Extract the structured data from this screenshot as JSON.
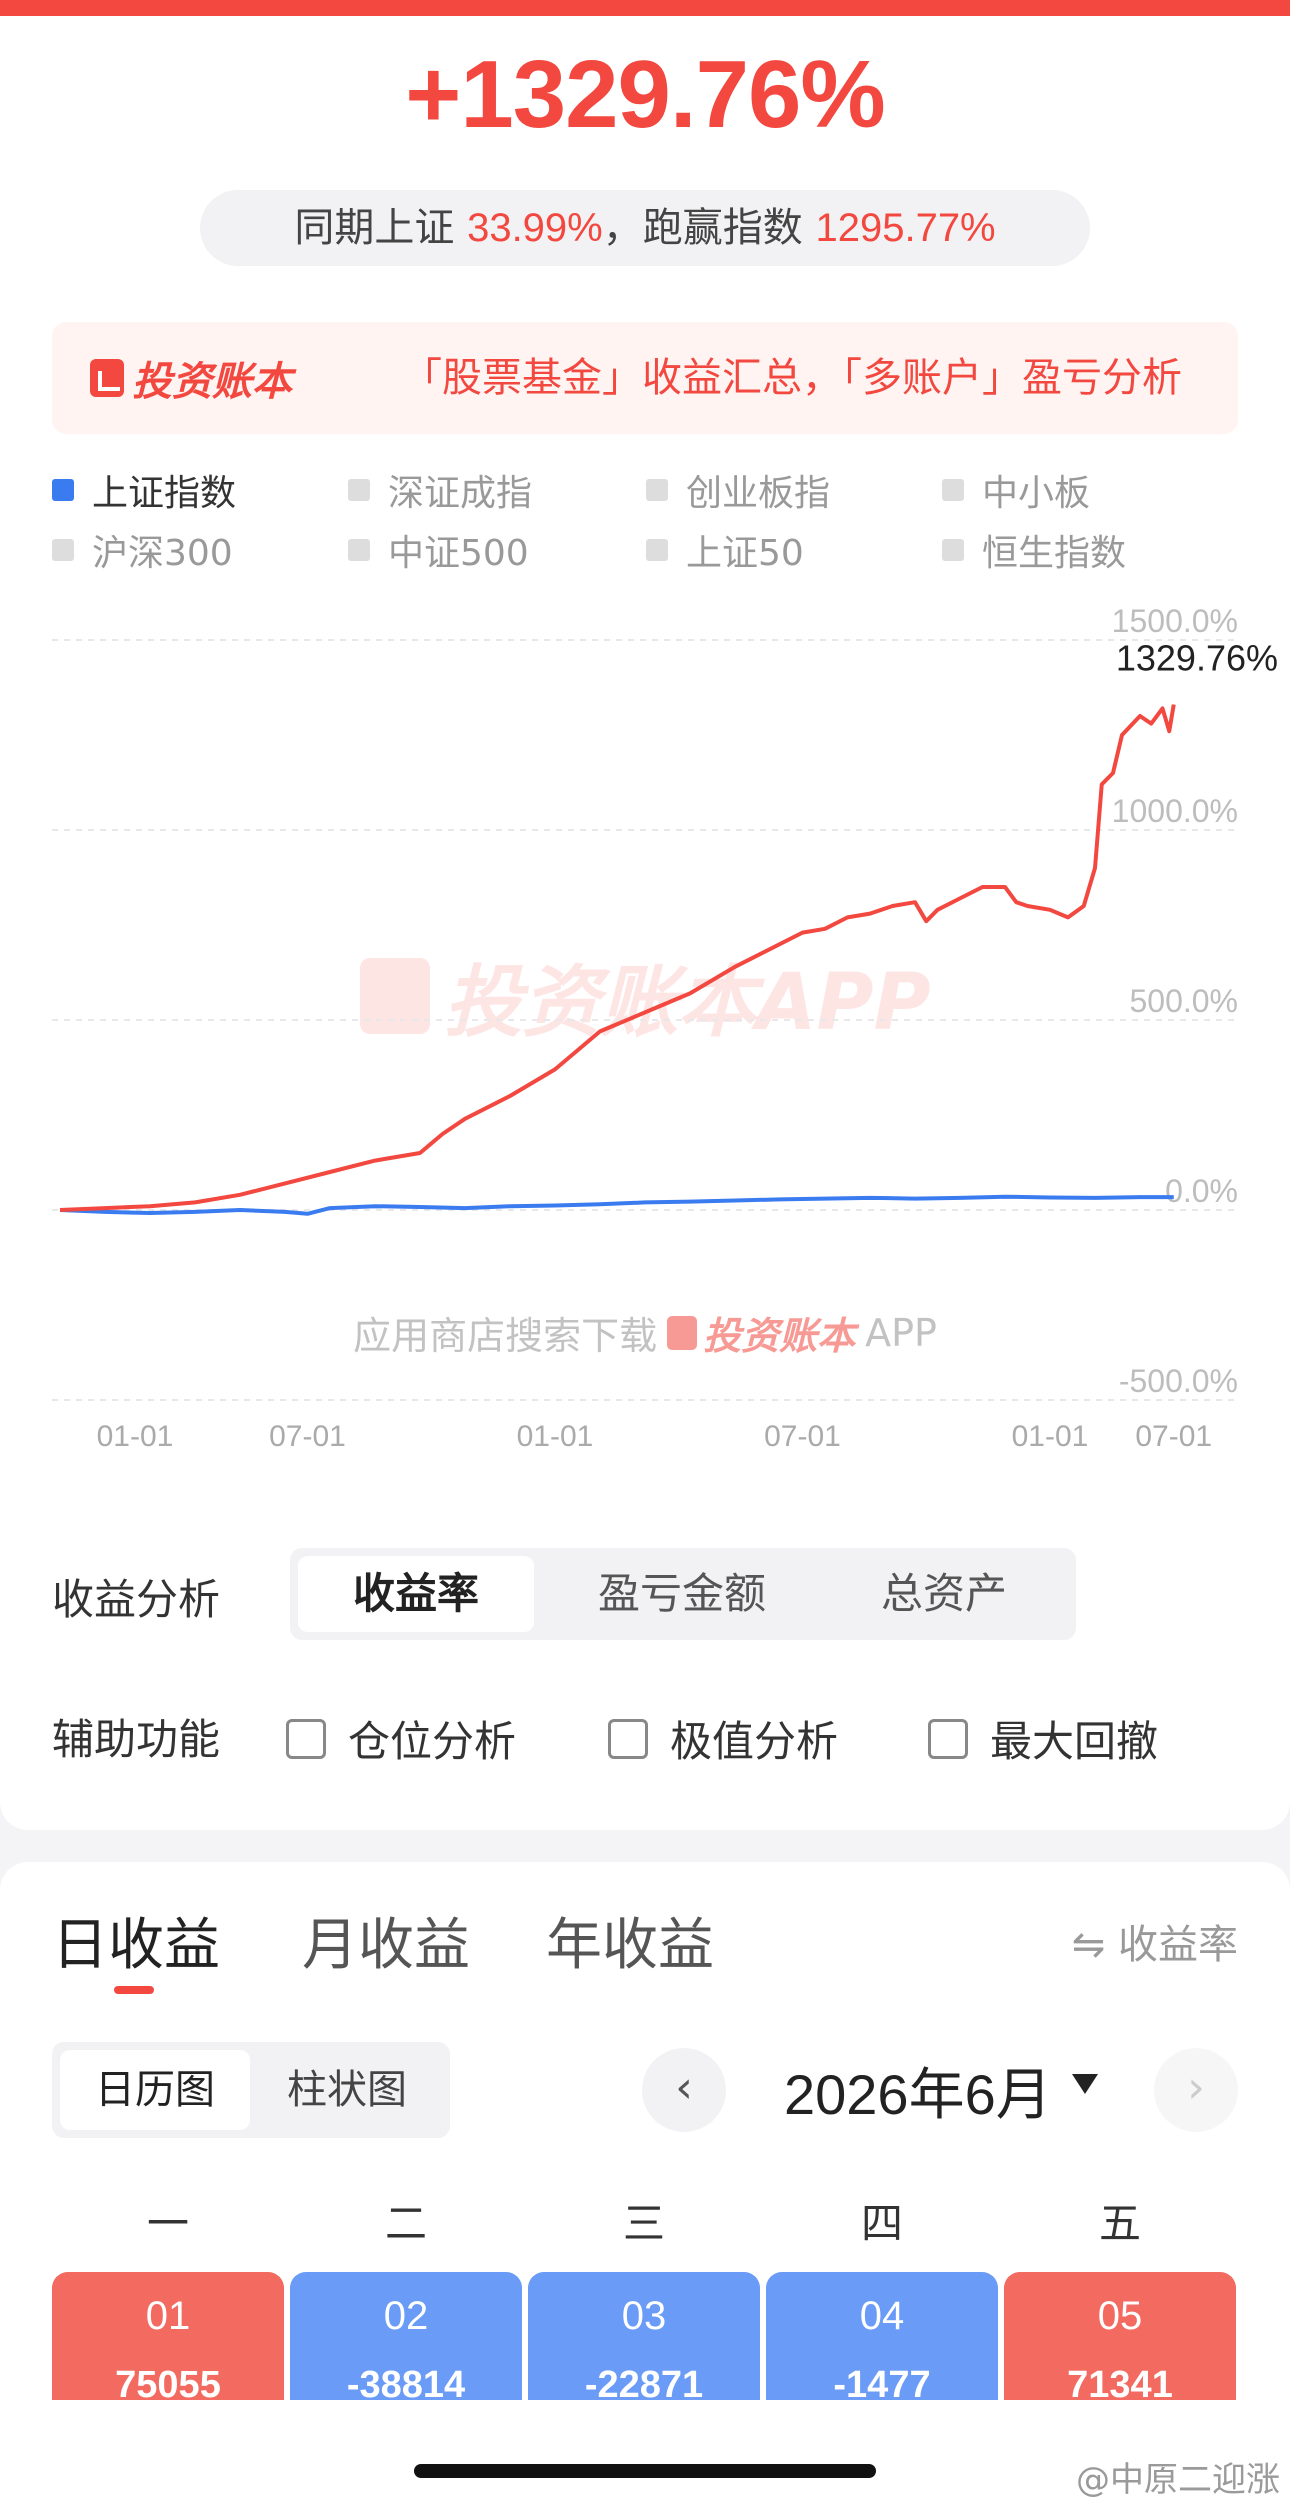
{
  "header": {
    "total_return": "+1329.76%",
    "compare_prefix": "同期上证 ",
    "compare_index_value": "33.99%",
    "compare_mid": "，跑赢指数 ",
    "compare_outperform_value": "1295.77%"
  },
  "promo": {
    "logo_text": "投资账本",
    "text": "「股票基金」收益汇总，「多账户」盈亏分析"
  },
  "legend": [
    {
      "label": "上证指数",
      "active": true
    },
    {
      "label": "深证成指",
      "active": false
    },
    {
      "label": "创业板指",
      "active": false
    },
    {
      "label": "中小板",
      "active": false
    },
    {
      "label": "沪深300",
      "active": false
    },
    {
      "label": "中证500",
      "active": false
    },
    {
      "label": "上证50",
      "active": false
    },
    {
      "label": "恒生指数",
      "active": false
    }
  ],
  "chart_data": {
    "type": "line",
    "y_ticks": [
      "1500.0%",
      "1000.0%",
      "500.0%",
      "0.0%",
      "-500.0%"
    ],
    "ylim": [
      -500,
      1500
    ],
    "x_ticks": [
      "01-01",
      "07-01",
      "01-01",
      "07-01",
      "01-01",
      "07-01"
    ],
    "end_label": "1329.76%",
    "series": [
      {
        "name": "",
        "color": "#f2483f",
        "points": [
          [
            0,
            0
          ],
          [
            2,
            5
          ],
          [
            4,
            10
          ],
          [
            6,
            20
          ],
          [
            8,
            40
          ],
          [
            10,
            70
          ],
          [
            12,
            100
          ],
          [
            14,
            130
          ],
          [
            16,
            150
          ],
          [
            17,
            200
          ],
          [
            18,
            240
          ],
          [
            20,
            300
          ],
          [
            22,
            370
          ],
          [
            23,
            420
          ],
          [
            24,
            470
          ],
          [
            26,
            520
          ],
          [
            28,
            570
          ],
          [
            30,
            640
          ],
          [
            32,
            700
          ],
          [
            33,
            730
          ],
          [
            34,
            740
          ],
          [
            35,
            770
          ],
          [
            36,
            780
          ],
          [
            37,
            800
          ],
          [
            38,
            810
          ],
          [
            38.5,
            760
          ],
          [
            39,
            790
          ],
          [
            40,
            820
          ],
          [
            41,
            850
          ],
          [
            42,
            850
          ],
          [
            42.5,
            810
          ],
          [
            43,
            800
          ],
          [
            44,
            790
          ],
          [
            44.8,
            770
          ],
          [
            45.5,
            800
          ],
          [
            46,
            900
          ],
          [
            46.3,
            1120
          ],
          [
            46.8,
            1150
          ],
          [
            47.2,
            1250
          ],
          [
            48,
            1300
          ],
          [
            48.5,
            1280
          ],
          [
            49,
            1320
          ],
          [
            49.3,
            1260
          ],
          [
            49.5,
            1330
          ]
        ]
      },
      {
        "name": "上证指数",
        "color": "#3b7bf0",
        "points": [
          [
            0,
            0
          ],
          [
            2,
            -5
          ],
          [
            4,
            -8
          ],
          [
            6,
            -5
          ],
          [
            8,
            0
          ],
          [
            10,
            -5
          ],
          [
            11,
            -10
          ],
          [
            12,
            5
          ],
          [
            14,
            10
          ],
          [
            16,
            8
          ],
          [
            18,
            5
          ],
          [
            20,
            10
          ],
          [
            22,
            12
          ],
          [
            24,
            15
          ],
          [
            26,
            20
          ],
          [
            28,
            22
          ],
          [
            30,
            25
          ],
          [
            32,
            28
          ],
          [
            34,
            30
          ],
          [
            36,
            32
          ],
          [
            38,
            30
          ],
          [
            40,
            32
          ],
          [
            42,
            35
          ],
          [
            44,
            33
          ],
          [
            46,
            32
          ],
          [
            48,
            34
          ],
          [
            49.5,
            34
          ]
        ]
      }
    ]
  },
  "watermark": {
    "text": "投资账本APP",
    "download_note": "应用商店搜索下载",
    "download_app": "投资账本",
    "download_suffix": "APP"
  },
  "analysis": {
    "label": "收益分析",
    "options": [
      "收益率",
      "盈亏金额",
      "总资产"
    ],
    "selected": "收益率"
  },
  "aux": {
    "label": "辅助功能",
    "options": [
      "仓位分析",
      "极值分析",
      "最大回撤"
    ]
  },
  "returns": {
    "tabs": [
      "日收益",
      "月收益",
      "年收益"
    ],
    "selected_tab": "日收益",
    "switch_label": "⇋ 收益率",
    "views": [
      "日历图",
      "柱状图"
    ],
    "selected_view": "日历图",
    "prev": "‹",
    "next": "›",
    "month": "2026年6月",
    "weekdays": [
      "一",
      "二",
      "三",
      "四",
      "五"
    ],
    "days": [
      {
        "num": "01",
        "value": "75055",
        "trend": "up"
      },
      {
        "num": "02",
        "value": "-38814",
        "trend": "down"
      },
      {
        "num": "03",
        "value": "-22871",
        "trend": "down"
      },
      {
        "num": "04",
        "value": "-1477",
        "trend": "down"
      },
      {
        "num": "05",
        "value": "71341",
        "trend": "up"
      }
    ]
  },
  "credit": "@中原二迎涨"
}
